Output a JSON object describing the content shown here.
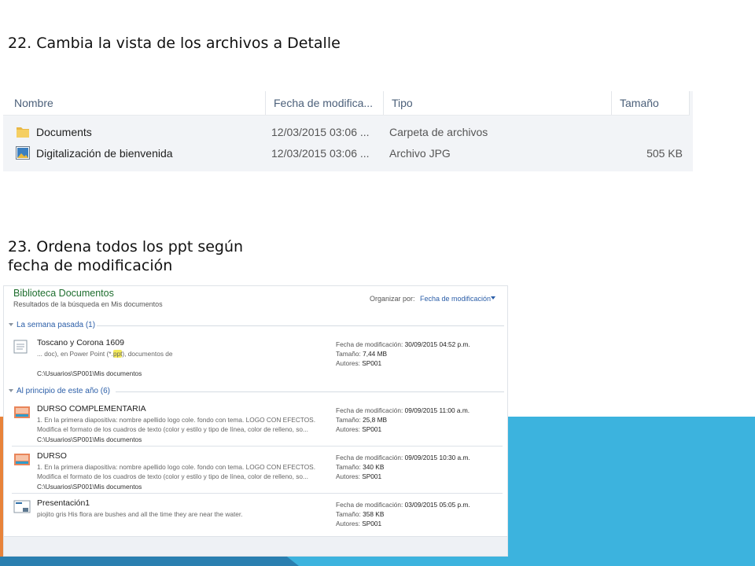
{
  "headings": {
    "step22": "22. Cambia la vista de los archivos a Detalle",
    "step23": "23.  Ordena todos los ppt según fecha de modificación"
  },
  "explorer": {
    "columns": [
      "Nombre",
      "Fecha de modifica...",
      "Tipo",
      "Tamaño"
    ],
    "rows": [
      {
        "name": "Documents",
        "date": "12/03/2015 03:06 ...",
        "type": "Carpeta de archivos",
        "size": "",
        "icon": "folder-icon"
      },
      {
        "name": "Digitalización de bienvenida",
        "date": "12/03/2015 03:06 ...",
        "type": "Archivo JPG",
        "size": "505 KB",
        "icon": "image-file-icon"
      }
    ]
  },
  "library": {
    "title": "Biblioteca Documentos",
    "subtitle": "Resultados de la búsqueda en Mis documentos",
    "sort_label": "Organizar por:",
    "sort_value": "Fecha de modificación",
    "groups": [
      {
        "label": "La semana pasada (1)",
        "items": [
          {
            "name": "Toscano y Corona 1609",
            "snippet_before": "... doc), en Power Point (*.",
            "snippet_highlight": "ppt",
            "snippet_after": "), documentos de",
            "snippet2": "",
            "path": "C:\\Usuarios\\SP001\\Mis documentos",
            "meta_date_label": "Fecha de modificación:",
            "meta_date": "30/09/2015 04:52 p.m.",
            "meta_size_label": "Tamaño:",
            "meta_size": "7,44 MB",
            "meta_author_label": "Autores:",
            "meta_author": "SP001",
            "icon": "document-icon"
          }
        ]
      },
      {
        "label": "Al principio de este año (6)",
        "items": [
          {
            "name": "DURSO COMPLEMENTARIA",
            "snippet_before": "1. En la primera diapositiva: nombre apellido logo cole. fondo con tema. LOGO CON EFECTOS.",
            "snippet_highlight": "",
            "snippet_after": "",
            "snippet2": "Modifica el formato de los cuadros de texto (color y estilo y tipo de línea, color de relleno, so...",
            "path": "C:\\Usuarios\\SP001\\Mis documentos",
            "meta_date_label": "Fecha de modificación:",
            "meta_date": "09/09/2015 11:00 a.m.",
            "meta_size_label": "Tamaño:",
            "meta_size": "25,8 MB",
            "meta_author_label": "Autores:",
            "meta_author": "SP001",
            "icon": "presentation-icon"
          },
          {
            "name": "DURSO",
            "snippet_before": "1. En la primera diapositiva: nombre apellido logo cole. fondo con tema. LOGO CON EFECTOS.",
            "snippet_highlight": "",
            "snippet_after": "",
            "snippet2": "Modifica el formato de los cuadros de texto (color y estilo y tipo de línea, color de relleno, so...",
            "path": "C:\\Usuarios\\SP001\\Mis documentos",
            "meta_date_label": "Fecha de modificación:",
            "meta_date": "09/09/2015 10:30 a.m.",
            "meta_size_label": "Tamaño:",
            "meta_size": "340 KB",
            "meta_author_label": "Autores:",
            "meta_author": "SP001",
            "icon": "presentation-icon"
          },
          {
            "name": "Presentación1",
            "snippet_before": "piojito gris His flora are bushes and all the time they are near the water.",
            "snippet_highlight": "",
            "snippet_after": "",
            "snippet2": "",
            "path": "",
            "meta_date_label": "Fecha de modificación:",
            "meta_date": "03/09/2015 05:05 p.m.",
            "meta_size_label": "Tamaño:",
            "meta_size": "358 KB",
            "meta_author_label": "Autores:",
            "meta_author": "SP001",
            "icon": "presentation-blank-icon"
          }
        ]
      }
    ]
  },
  "colors": {
    "accent": "#3cb3de",
    "accent_dark": "#2a7fb0",
    "library_title": "#1e6e2e",
    "link_blue": "#2b5ea8",
    "highlight": "#f4ea5a"
  }
}
